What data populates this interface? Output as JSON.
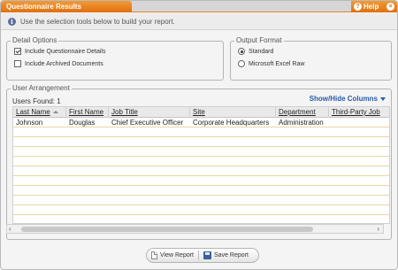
{
  "window": {
    "title": "Questionnaire Results",
    "help_label": "Help",
    "close_glyph": "×",
    "info_text": "Use the selection tools below to build your report."
  },
  "detail_options": {
    "legend": "Detail Options",
    "items": [
      {
        "label": "Include Questionnaire Details",
        "checked": true
      },
      {
        "label": "Include Archived Documents",
        "checked": false
      }
    ]
  },
  "output_format": {
    "legend": "Output Format",
    "options": [
      {
        "label": "Standard",
        "selected": true
      },
      {
        "label": "Microsoft Excel Raw",
        "selected": false
      }
    ]
  },
  "user_arrangement": {
    "legend": "User Arrangement",
    "users_found": "Users Found: 1",
    "show_hide_label": "Show/Hide Columns",
    "columns": [
      "Last Name",
      "First Name",
      "Job Title",
      "Site",
      "Department",
      "Third-Party Job"
    ],
    "rows": [
      [
        "Johnson",
        "Douglas",
        "Chief Executive Officer",
        "Corporate Headquarters",
        "Administration",
        ""
      ]
    ]
  },
  "scrollbar": {
    "left_glyph": "‹",
    "right_glyph": "›"
  },
  "footer": {
    "view_report_label": "View Report",
    "save_report_label": "Save Report"
  },
  "icons": {
    "help": "help-icon",
    "close": "close-icon",
    "info": "info-icon",
    "view_report": "document-icon",
    "save_report": "disk-icon"
  },
  "colors": {
    "accent": "#e67e22",
    "link": "#2a5aa8",
    "info_icon": "#5b6f9c"
  }
}
